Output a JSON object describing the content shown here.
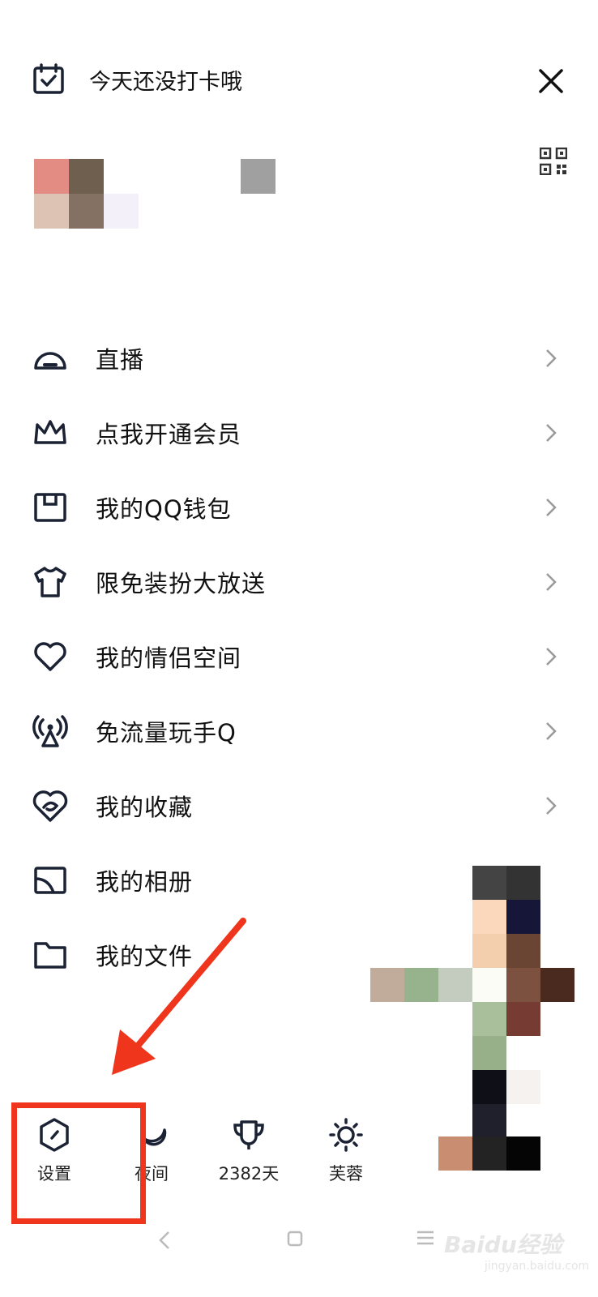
{
  "header": {
    "checkin_text": "今天还没打卡哦"
  },
  "menu": {
    "items": [
      {
        "label": "直播",
        "icon": "live-icon"
      },
      {
        "label": "点我开通会员",
        "icon": "crown-icon"
      },
      {
        "label": "我的QQ钱包",
        "icon": "wallet-icon"
      },
      {
        "label": "限免装扮大放送",
        "icon": "tshirt-icon"
      },
      {
        "label": "我的情侣空间",
        "icon": "heart-icon"
      },
      {
        "label": "免流量玩手Q",
        "icon": "antenna-icon"
      },
      {
        "label": "我的收藏",
        "icon": "favorite-icon"
      },
      {
        "label": "我的相册",
        "icon": "album-icon"
      },
      {
        "label": "我的文件",
        "icon": "folder-icon"
      }
    ]
  },
  "quickbar": {
    "settings_label": "设置",
    "night_label": "夜间",
    "days_label": "2382天",
    "weather_label": "芙蓉"
  },
  "watermark": {
    "brand": "Baidu经验",
    "url": "jingyan.baidu.com"
  },
  "colors": {
    "highlight": "#f0351d",
    "text": "#111111"
  }
}
